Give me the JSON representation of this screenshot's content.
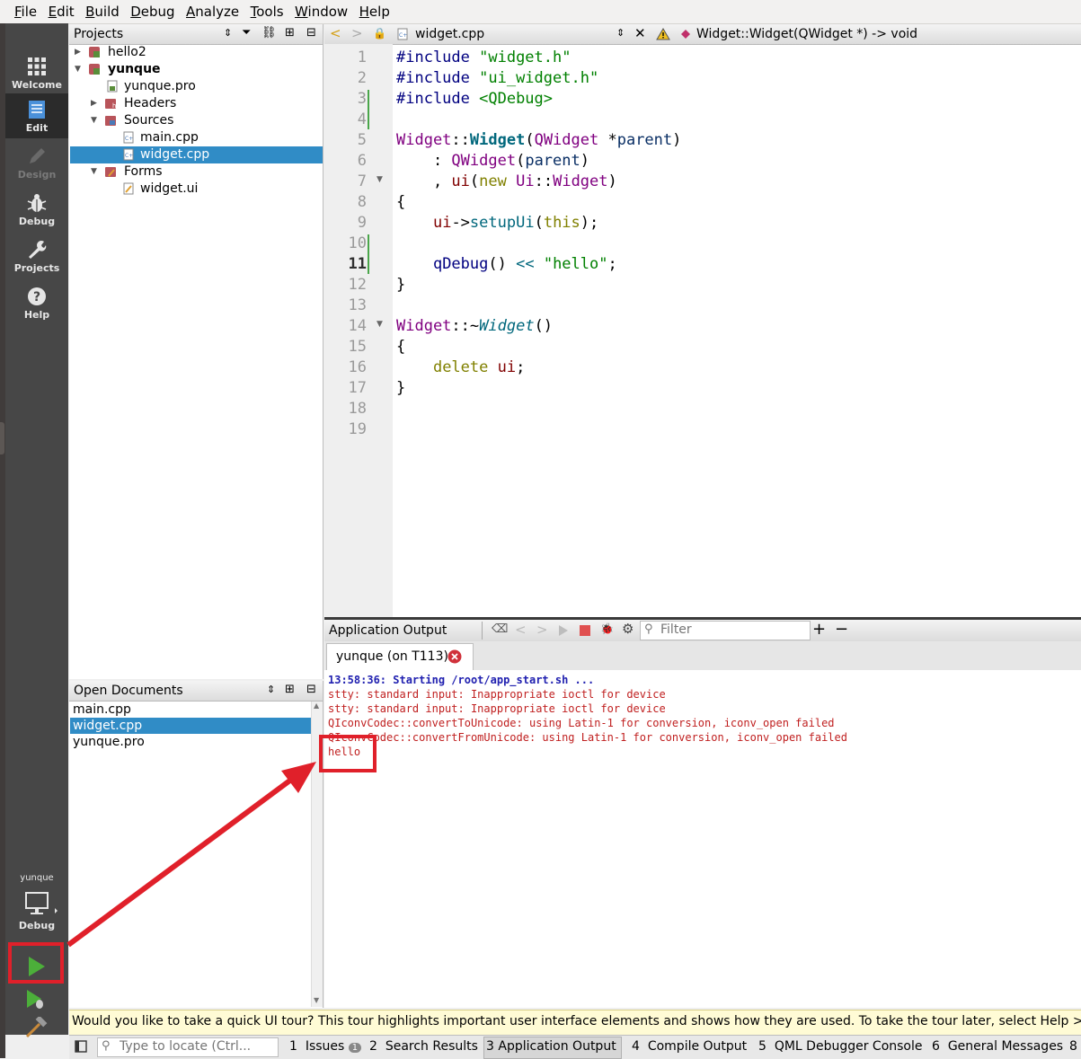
{
  "menu": [
    "File",
    "Edit",
    "Build",
    "Debug",
    "Analyze",
    "Tools",
    "Window",
    "Help"
  ],
  "menu_mnemonics": [
    "F",
    "E",
    "B",
    "D",
    "A",
    "T",
    "W",
    "H"
  ],
  "menu_rest": [
    "ile",
    "dit",
    "uild",
    "ebug",
    "nalyze",
    "ools",
    "indow",
    "elp"
  ],
  "modes": [
    {
      "label": "Welcome",
      "icon": "grid-icon"
    },
    {
      "label": "Edit",
      "icon": "document-icon"
    },
    {
      "label": "Design",
      "icon": "pencil-icon"
    },
    {
      "label": "Debug",
      "icon": "bug-icon"
    },
    {
      "label": "Projects",
      "icon": "wrench-icon"
    },
    {
      "label": "Help",
      "icon": "question-icon"
    }
  ],
  "kit": {
    "name": "yunque",
    "config": "Debug"
  },
  "projects_panel": {
    "title": "Projects"
  },
  "tree": [
    {
      "label": "hello2",
      "depth": 0,
      "arrow": "▸"
    },
    {
      "label": "yunque",
      "depth": 0,
      "arrow": "▾",
      "bold": true
    },
    {
      "label": "yunque.pro",
      "depth": 1,
      "arrow": ""
    },
    {
      "label": "Headers",
      "depth": 1,
      "arrow": "▸"
    },
    {
      "label": "Sources",
      "depth": 1,
      "arrow": "▾"
    },
    {
      "label": "main.cpp",
      "depth": 2,
      "arrow": ""
    },
    {
      "label": "widget.cpp",
      "depth": 2,
      "arrow": "",
      "selected": true
    },
    {
      "label": "Forms",
      "depth": 1,
      "arrow": "▾"
    },
    {
      "label": "widget.ui",
      "depth": 2,
      "arrow": ""
    }
  ],
  "editor": {
    "filename": "widget.cpp",
    "symbol": "Widget::Widget(QWidget *) -> void",
    "current_line": "11",
    "line_numbers": [
      "1",
      "2",
      "3",
      "4",
      "5",
      "6",
      "7",
      "8",
      "9",
      "10",
      "11",
      "12",
      "13",
      "14",
      "15",
      "16",
      "17",
      "18",
      "19"
    ]
  },
  "code": {
    "l1a": "#include ",
    "l1b": "\"widget.h\"",
    "l2a": "#include ",
    "l2b": "\"ui_widget.h\"",
    "l3a": "#include ",
    "l3b": "<QDebug>",
    "l5a": "Widget",
    "l5b": "::",
    "l5c": "Widget",
    "l5d": "(",
    "l5e": "QWidget",
    "l5f": " *",
    "l5g": "parent",
    "l5h": ")",
    "l6a": "    : ",
    "l6b": "QWidget",
    "l6c": "(",
    "l6d": "parent",
    "l6e": ")",
    "l7a": "    , ",
    "l7b": "ui",
    "l7c": "(",
    "l7d": "new",
    "l7e": " ",
    "l7f": "Ui",
    "l7g": "::",
    "l7h": "Widget",
    "l7i": ")",
    "l8": "{",
    "l9a": "    ",
    "l9b": "ui",
    "l9c": "->",
    "l9d": "setupUi",
    "l9e": "(",
    "l9f": "this",
    "l9g": ");",
    "l11a": "    ",
    "l11b": "qDebug",
    "l11c": "() ",
    "l11d": "<<",
    "l11e": " ",
    "l11f": "\"hello\"",
    "l11g": ";",
    "l12": "}",
    "l14a": "Widget",
    "l14b": "::~",
    "l14c": "Widget",
    "l14d": "()",
    "l15": "{",
    "l16a": "    ",
    "l16b": "delete",
    "l16c": " ",
    "l16d": "ui",
    "l16e": ";",
    "l17": "}"
  },
  "output": {
    "title": "Application Output",
    "filter_placeholder": "Filter",
    "tab": "yunque (on T113)",
    "lines": [
      "13:58:36: Starting /root/app_start.sh ...",
      "stty: standard input: Inappropriate ioctl for device",
      "stty: standard input: Inappropriate ioctl for device",
      "QIconvCodec::convertToUnicode: using Latin-1 for conversion, iconv_open failed",
      "QIconvCodec::convertFromUnicode: using Latin-1 for conversion, iconv_open failed",
      "hello"
    ]
  },
  "open_documents": {
    "title": "Open Documents",
    "items": [
      "main.cpp",
      "widget.cpp",
      "yunque.pro"
    ]
  },
  "info_bar": "Would you like to take a quick UI tour? This tour highlights important user interface elements and shows how they are used. To take the tour later, select Help > UI Tour",
  "locator_placeholder": "Type to locate (Ctrl...",
  "status_tabs": [
    {
      "num": "1",
      "label": "Issues",
      "badge": "1"
    },
    {
      "num": "2",
      "label": "Search Results"
    },
    {
      "num": "3",
      "label": "Application Output",
      "active": true
    },
    {
      "num": "4",
      "label": "Compile Output"
    },
    {
      "num": "5",
      "label": "QML Debugger Console"
    },
    {
      "num": "6",
      "label": "General Messages"
    },
    {
      "num": "8",
      "label": ""
    }
  ],
  "colors": {
    "accent": "#308cc6",
    "annotation": "#e0202a",
    "run_green": "#4caf3a"
  }
}
